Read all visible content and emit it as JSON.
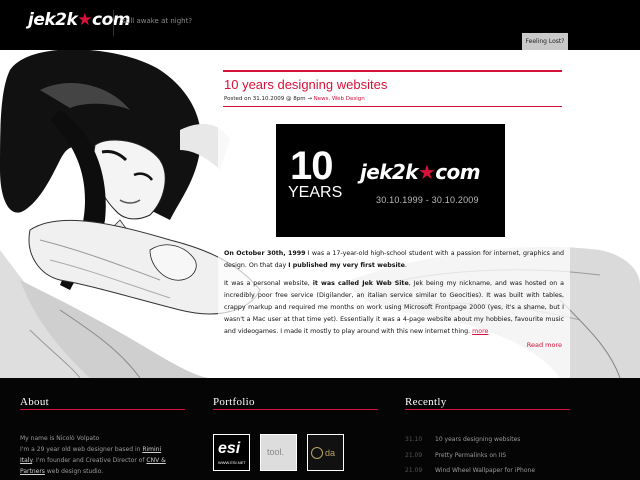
{
  "header": {
    "logo_text_a": "jek2k",
    "logo_star": "★",
    "logo_text_b": "com",
    "tagline": "still awake at night?",
    "feeling_lost": "Feeling Lost?"
  },
  "post": {
    "title": "10 years designing websites",
    "meta_prefix": "Posted on 31.10.2009 @ 8pm → ",
    "meta_categories": "News, Web Design",
    "banner": {
      "number": "10",
      "years": "YEARS",
      "logo_a": "jek2k",
      "logo_star": "★",
      "logo_b": "com",
      "dates": "30.10.1999 - 30.10.2009"
    },
    "para1_lead": "On October 30th, 1999",
    "para1_rest": " I was a 17-year-old high-school student with a passion for internet, graphics and design. On that day ",
    "para1_bold": "I published my very first website",
    "para1_end": ".",
    "para2_a": "It was a personal website, ",
    "para2_bold": "it was called Jek Web Site",
    "para2_b": ", Jek being my nickname, and was hosted on a incredibly poor free service (Digilander, an italian service similar to Geocities). It was built with tables, crappy markup and required me months on work using Microsoft Frontpage 2000 (yes, it's a shame, but I wasn't a Mac user at that time yet). Essentially it was a 4-page website about my hobbies, favourite music and videogames. I made it mostly to play around with this new internet thing. ",
    "more_link": "more",
    "read_more": "Read more"
  },
  "footer": {
    "about": {
      "title": "About",
      "line1": "My name is Nicolò Volpato",
      "line2a": "I'm a 29 year old web designer based in ",
      "rimini": "Rimini",
      "line3a": "Italy",
      "line3b": ". I'm founder and Creative Director of ",
      "cnv": "CNV &",
      "line4a": "Partners",
      "line4b": " web design studio."
    },
    "portfolio": {
      "title": "Portfolio",
      "thumb1_label": "esi",
      "thumb1_sub": "WWW.ESI.NET",
      "thumb2_label": "tool.",
      "thumb3_label": "da"
    },
    "recently": {
      "title": "Recently",
      "items": [
        {
          "date": "31.10",
          "title": "10 years designing websites"
        },
        {
          "date": "21.09",
          "title": "Pretty Permalinks on IIS"
        },
        {
          "date": "21.09",
          "title": "Wind Wheel Wallpaper for iPhone"
        }
      ]
    }
  }
}
